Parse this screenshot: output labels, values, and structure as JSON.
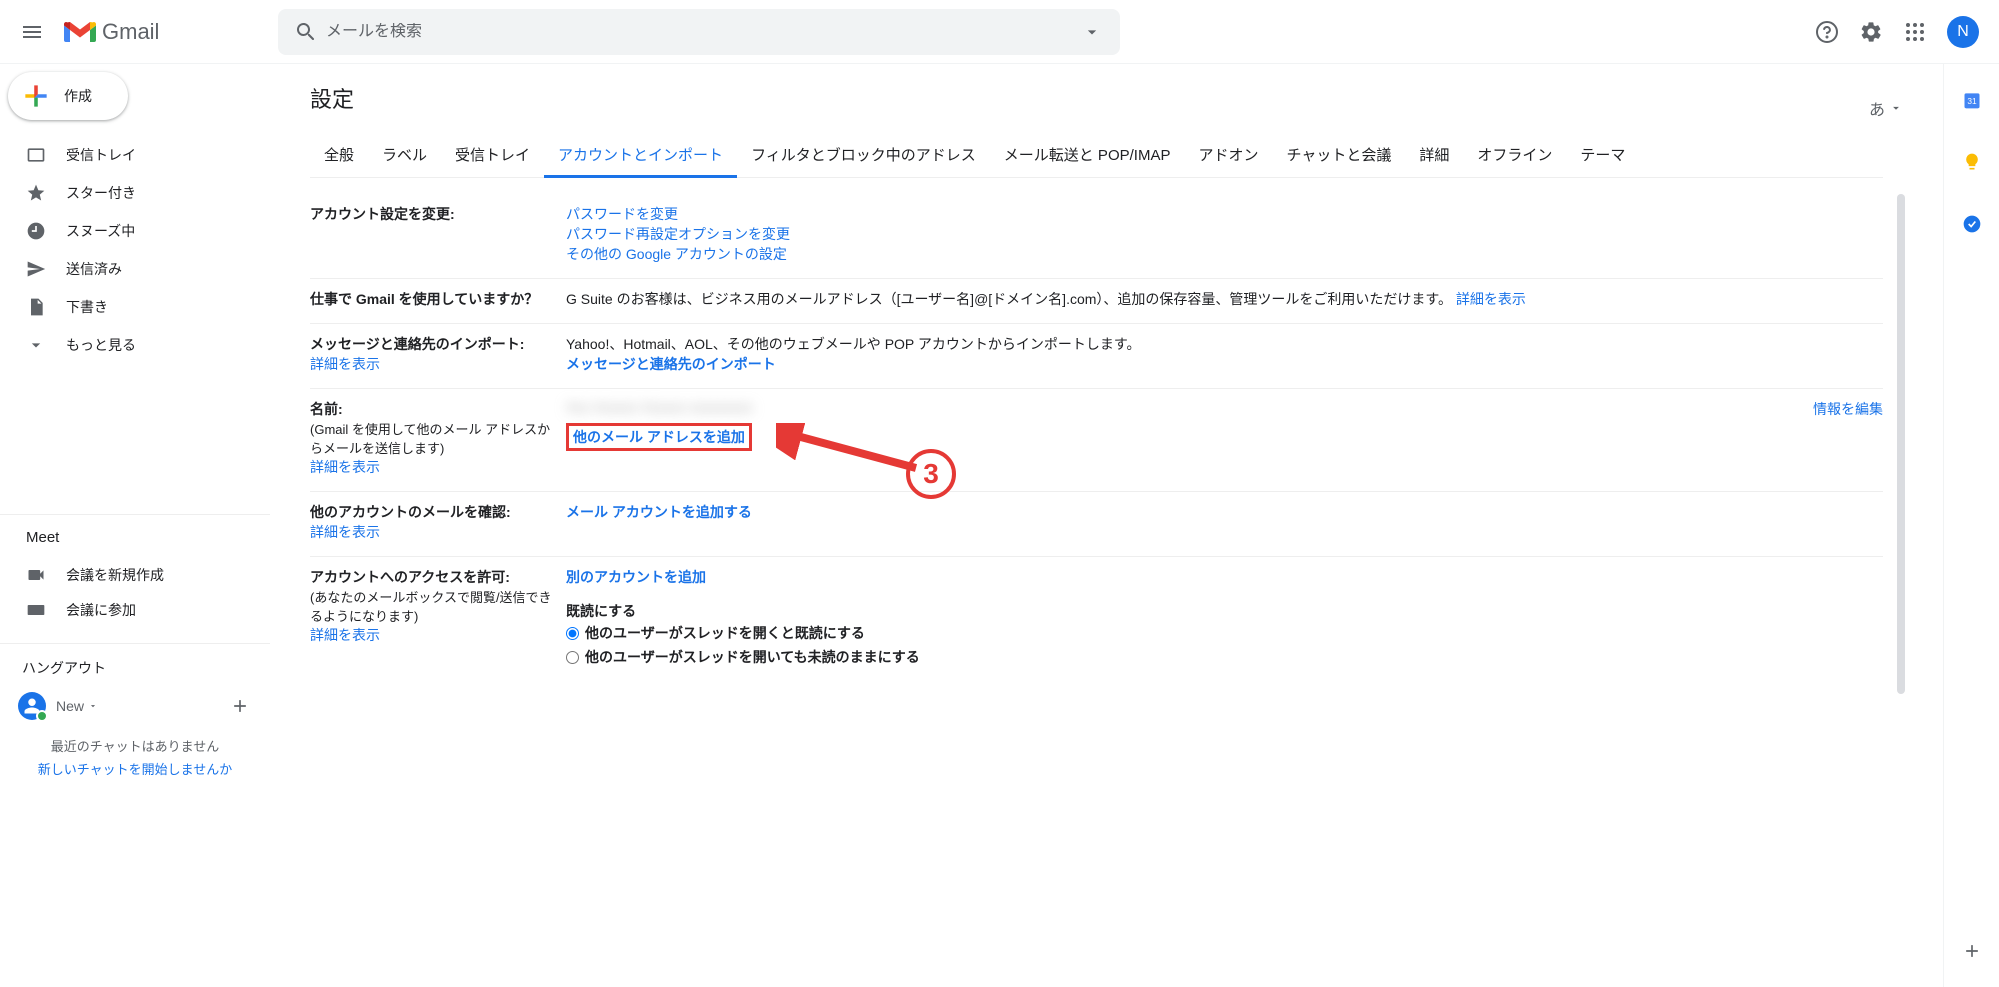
{
  "header": {
    "logo_text": "Gmail",
    "search_placeholder": "メールを検索",
    "avatar_initial": "N"
  },
  "compose_label": "作成",
  "nav": {
    "inbox": "受信トレイ",
    "starred": "スター付き",
    "snoozed": "スヌーズ中",
    "sent": "送信済み",
    "drafts": "下書き",
    "more": "もっと見る"
  },
  "meet": {
    "title": "Meet",
    "new": "会議を新規作成",
    "join": "会議に参加"
  },
  "hangouts": {
    "title": "ハングアウト",
    "user": "New",
    "no_chats": "最近のチャットはありません",
    "start_chat": "新しいチャットを開始しませんか"
  },
  "settings": {
    "title": "設定",
    "lang": "あ",
    "tabs": {
      "general": "全般",
      "labels": "ラベル",
      "inbox": "受信トレイ",
      "accounts": "アカウントとインポート",
      "filters": "フィルタとブロック中のアドレス",
      "forwarding": "メール転送と POP/IMAP",
      "addons": "アドオン",
      "chat": "チャットと会議",
      "advanced": "詳細",
      "offline": "オフライン",
      "themes": "テーマ"
    },
    "sections": {
      "change_account": {
        "label": "アカウント設定を変更:",
        "change_password": "パスワードを変更",
        "change_recovery": "パスワード再設定オプションを変更",
        "other_settings": "その他の Google アカウントの設定"
      },
      "gsuite": {
        "label": "仕事で Gmail を使用していますか？",
        "desc_prefix": "G Suite のお客様は、ビジネス用のメールアドレス（[ユーザー名]@[ドメイン名].com）、追加の保存容量、管理ツールをご利用いただけます。",
        "learn_more": "詳細を表示"
      },
      "import": {
        "label": "メッセージと連絡先のインポート:",
        "desc": "Yahoo!、Hotmail、AOL、その他のウェブメールや POP アカウントからインポートします。",
        "link": "メッセージと連絡先のインポート",
        "learn_more": "詳細を表示"
      },
      "send_as": {
        "label": "名前:",
        "sub": "(Gmail を使用して他のメール アドレスからメールを送信します)",
        "blurred": "Xxx Xxxxxx Xxxxxx xxxxxxxxx",
        "add_another": "他のメール アドレスを追加",
        "edit": "情報を編集",
        "learn_more": "詳細を表示"
      },
      "check_mail": {
        "label": "他のアカウントのメールを確認:",
        "link": "メール アカウントを追加する",
        "learn_more": "詳細を表示"
      },
      "grant": {
        "label": "アカウントへのアクセスを許可:",
        "sub": "(あなたのメールボックスで閲覧/送信できるようになります)",
        "link": "別のアカウントを追加",
        "mark_read": "既読にする",
        "opt1": "他のユーザーがスレッドを開くと既読にする",
        "opt2": "他のユーザーがスレッドを開いても未読のままにする",
        "learn_more": "詳細を表示"
      }
    }
  },
  "annotation": {
    "number": "3"
  }
}
